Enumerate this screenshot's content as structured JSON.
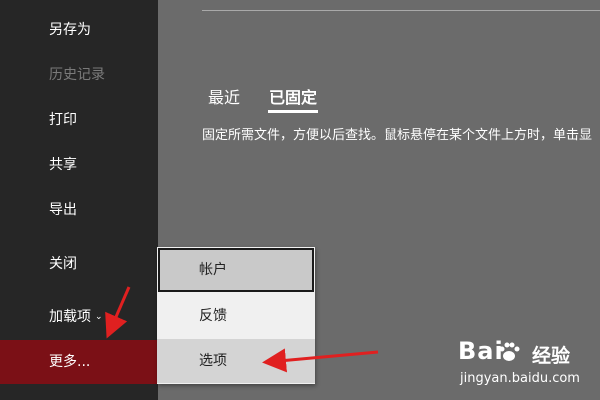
{
  "sidebar": {
    "items": [
      {
        "label": "另存为"
      },
      {
        "label": "历史记录"
      },
      {
        "label": "打印"
      },
      {
        "label": "共享"
      },
      {
        "label": "导出"
      },
      {
        "label": "关闭"
      },
      {
        "label": "加载项"
      },
      {
        "label": "更多..."
      }
    ],
    "addins_chevron": "⌄"
  },
  "main": {
    "tabs": [
      {
        "label": "最近"
      },
      {
        "label": "已固定",
        "selected": true
      }
    ],
    "description": "固定所需文件，方便以后查找。鼠标悬停在某个文件上方时，单击显"
  },
  "popup": {
    "items": [
      {
        "label": "帐户"
      },
      {
        "label": "反馈"
      },
      {
        "label": "选项"
      }
    ]
  },
  "watermark": {
    "brand": "Bai",
    "brand_suffix": "经验",
    "url": "jingyan.baidu.com"
  },
  "colors": {
    "sidebar_bg": "#262626",
    "active_item_bg": "#7b1016",
    "content_bg": "#6b6b6b",
    "annotation_arrow": "#e02020"
  }
}
